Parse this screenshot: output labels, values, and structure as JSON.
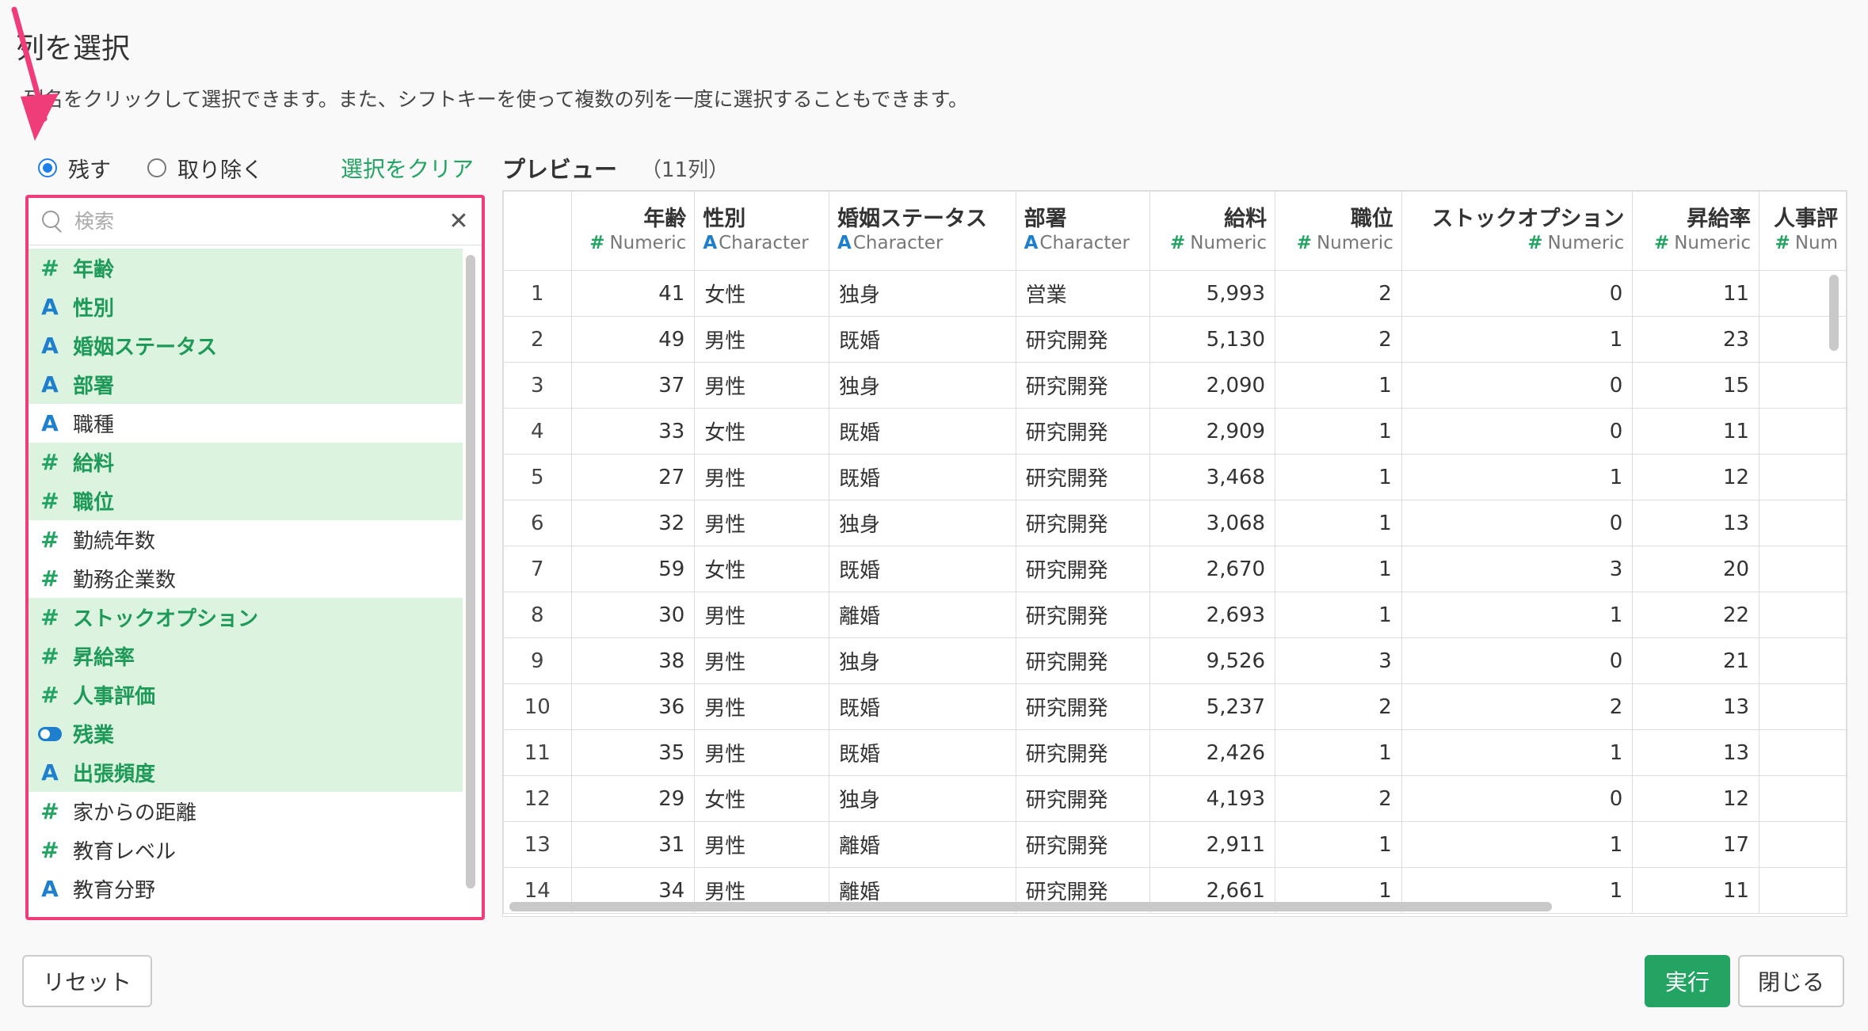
{
  "page": {
    "title": "列を選択",
    "description": "列名をクリックして選択できます。また、シフトキーを使って複数の列を一度に選択することもできます。"
  },
  "mode": {
    "keep_label": "残す",
    "remove_label": "取り除く",
    "selected": "keep",
    "clear_label": "選択をクリア",
    "preview_label": "プレビュー",
    "preview_count": "（11列）"
  },
  "search": {
    "placeholder": "検索",
    "value": ""
  },
  "columns": [
    {
      "name": "年齢",
      "type": "numeric",
      "selected": true
    },
    {
      "name": "性別",
      "type": "character",
      "selected": true
    },
    {
      "name": "婚姻ステータス",
      "type": "character",
      "selected": true
    },
    {
      "name": "部署",
      "type": "character",
      "selected": true
    },
    {
      "name": "職種",
      "type": "character",
      "selected": false
    },
    {
      "name": "給料",
      "type": "numeric",
      "selected": true
    },
    {
      "name": "職位",
      "type": "numeric",
      "selected": true
    },
    {
      "name": "勤続年数",
      "type": "numeric",
      "selected": false
    },
    {
      "name": "勤務企業数",
      "type": "numeric",
      "selected": false
    },
    {
      "name": "ストックオプション",
      "type": "numeric",
      "selected": true
    },
    {
      "name": "昇給率",
      "type": "numeric",
      "selected": true
    },
    {
      "name": "人事評価",
      "type": "numeric",
      "selected": true
    },
    {
      "name": "残業",
      "type": "logical",
      "selected": true
    },
    {
      "name": "出張頻度",
      "type": "character",
      "selected": true
    },
    {
      "name": "家からの距離",
      "type": "numeric",
      "selected": false
    },
    {
      "name": "教育レベル",
      "type": "numeric",
      "selected": false
    },
    {
      "name": "教育分野",
      "type": "character",
      "selected": false
    }
  ],
  "preview": {
    "headers": [
      {
        "name": "年齢",
        "type": "Numeric",
        "kind": "num"
      },
      {
        "name": "性別",
        "type": "Character",
        "kind": "chr"
      },
      {
        "name": "婚姻ステータス",
        "type": "Character",
        "kind": "chr"
      },
      {
        "name": "部署",
        "type": "Character",
        "kind": "chr"
      },
      {
        "name": "給料",
        "type": "Numeric",
        "kind": "num"
      },
      {
        "name": "職位",
        "type": "Numeric",
        "kind": "num"
      },
      {
        "name": "ストックオプション",
        "type": "Numeric",
        "kind": "num"
      },
      {
        "name": "昇給率",
        "type": "Numeric",
        "kind": "num"
      },
      {
        "name": "人事評",
        "type": "Num",
        "kind": "num"
      }
    ],
    "rows": [
      [
        "1",
        "41",
        "女性",
        "独身",
        "営業",
        "5,993",
        "2",
        "0",
        "11",
        ""
      ],
      [
        "2",
        "49",
        "男性",
        "既婚",
        "研究開発",
        "5,130",
        "2",
        "1",
        "23",
        ""
      ],
      [
        "3",
        "37",
        "男性",
        "独身",
        "研究開発",
        "2,090",
        "1",
        "0",
        "15",
        ""
      ],
      [
        "4",
        "33",
        "女性",
        "既婚",
        "研究開発",
        "2,909",
        "1",
        "0",
        "11",
        ""
      ],
      [
        "5",
        "27",
        "男性",
        "既婚",
        "研究開発",
        "3,468",
        "1",
        "1",
        "12",
        ""
      ],
      [
        "6",
        "32",
        "男性",
        "独身",
        "研究開発",
        "3,068",
        "1",
        "0",
        "13",
        ""
      ],
      [
        "7",
        "59",
        "女性",
        "既婚",
        "研究開発",
        "2,670",
        "1",
        "3",
        "20",
        ""
      ],
      [
        "8",
        "30",
        "男性",
        "離婚",
        "研究開発",
        "2,693",
        "1",
        "1",
        "22",
        ""
      ],
      [
        "9",
        "38",
        "男性",
        "独身",
        "研究開発",
        "9,526",
        "3",
        "0",
        "21",
        ""
      ],
      [
        "10",
        "36",
        "男性",
        "既婚",
        "研究開発",
        "5,237",
        "2",
        "2",
        "13",
        ""
      ],
      [
        "11",
        "35",
        "男性",
        "既婚",
        "研究開発",
        "2,426",
        "1",
        "1",
        "13",
        ""
      ],
      [
        "12",
        "29",
        "女性",
        "独身",
        "研究開発",
        "4,193",
        "2",
        "0",
        "12",
        ""
      ],
      [
        "13",
        "31",
        "男性",
        "離婚",
        "研究開発",
        "2,911",
        "1",
        "1",
        "17",
        ""
      ],
      [
        "14",
        "34",
        "男性",
        "離婚",
        "研究開発",
        "2,661",
        "1",
        "1",
        "11",
        ""
      ]
    ]
  },
  "footer": {
    "reset_label": "リセット",
    "run_label": "実行",
    "close_label": "閉じる"
  },
  "colors": {
    "accent_green": "#23a463",
    "accent_blue": "#1e7fcc",
    "highlight_pink": "#ee3d78",
    "selected_bg": "#dcf3df"
  }
}
